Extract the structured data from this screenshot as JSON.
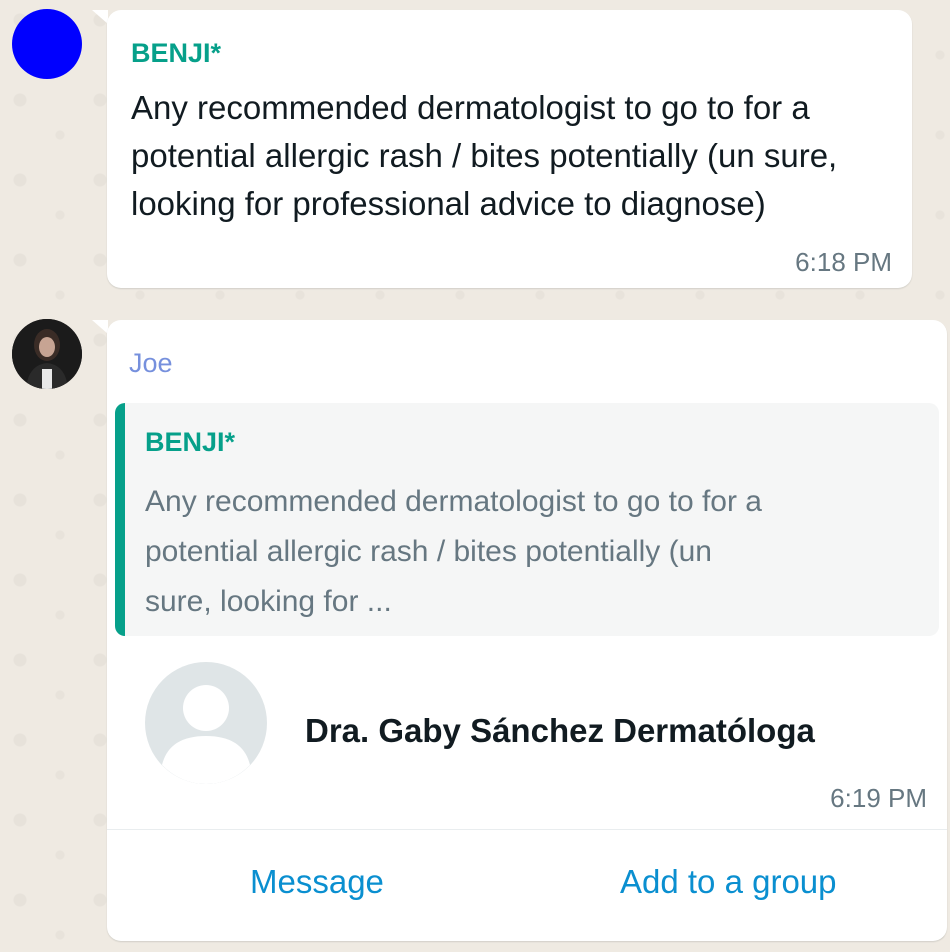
{
  "messages": [
    {
      "sender": "BENJI*",
      "text": "Any recommended dermatologist to go to for a potential allergic rash / bites potentially (un sure, looking for professional advice to diagnose)",
      "time": "6:18 PM",
      "avatar_color": "#0000ff"
    },
    {
      "sender": "Joe",
      "quoted": {
        "sender": "BENJI*",
        "text": "Any recommended dermatologist to go to for a potential allergic rash / bites potentially (un sure, looking for ..."
      },
      "contact_card": {
        "name": "Dra. Gaby Sánchez Dermatóloga",
        "time": "6:19 PM",
        "actions": {
          "message": "Message",
          "add_to_group": "Add to a group"
        }
      }
    }
  ],
  "colors": {
    "background": "#efeae2",
    "bubble": "#ffffff",
    "quote_sender": "#06a08a",
    "joe_name": "#7690dd",
    "link": "#0a8fd0"
  }
}
